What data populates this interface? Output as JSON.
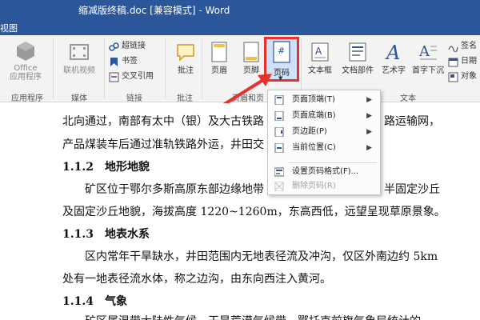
{
  "window": {
    "title": "缩减版终稿.doc [兼容模式] - Word"
  },
  "tabs": {
    "view": "视图"
  },
  "ribbon": {
    "office_apps": "Office\n应用程序",
    "online_video": "联机视频",
    "hyperlink": "超链接",
    "bookmark": "书签",
    "cross_ref": "交叉引用",
    "comment": "批注",
    "header": "页眉",
    "footer": "页脚",
    "page_number": "页码",
    "textbox": "文本框",
    "quick_parts": "文档部件",
    "wordart": "艺术字",
    "drop_cap": "首字下沉",
    "signature": "签名",
    "date": "日期",
    "object": "对象",
    "groups": {
      "apps": "应用程序",
      "media": "媒体",
      "links": "链接",
      "comments": "批注",
      "header_footer": "页眉和页",
      "text": "文本"
    }
  },
  "menu": {
    "items": [
      {
        "label": "页面顶端(T)",
        "submenu": true,
        "enabled": true,
        "icon": "page-top-icon"
      },
      {
        "label": "页面底端(B)",
        "submenu": true,
        "enabled": true,
        "icon": "page-bottom-icon"
      },
      {
        "label": "页边距(P)",
        "submenu": true,
        "enabled": true,
        "icon": "page-margin-icon"
      },
      {
        "label": "当前位置(C)",
        "submenu": true,
        "enabled": true,
        "icon": "current-position-icon"
      },
      {
        "label": "设置页码格式(F)...",
        "submenu": false,
        "enabled": true,
        "icon": "format-page-number-icon"
      },
      {
        "label": "删除页码(R)",
        "submenu": false,
        "enabled": false,
        "icon": "remove-page-number-icon"
      }
    ]
  },
  "document": {
    "lines": [
      {
        "text": "北向通过，南部有太中（银）及大古铁路",
        "tail": "路运输网，",
        "kind": "body"
      },
      {
        "text": "产品煤装车后通过准轨铁路外运，井田交",
        "tail": "",
        "kind": "body"
      },
      {
        "text": "1.1.2　地形地貌",
        "tail": "",
        "kind": "heading"
      },
      {
        "text": "　　矿区位于鄂尔多斯高原东部边缘地带",
        "tail": "半固定沙丘",
        "kind": "body"
      },
      {
        "text": "及固定沙丘地貌，海拔高度 1220~1260m，东高西低，远望呈现草原景象。",
        "tail": "",
        "kind": "body"
      },
      {
        "text": "1.1.3　地表水系",
        "tail": "",
        "kind": "heading"
      },
      {
        "text": "　　区内常年干旱缺水，井田范围内无地表径流及冲沟，仅区外南边约 5km",
        "tail": "",
        "kind": "body"
      },
      {
        "text": "处有一地表径流水体，称之边沟，由东向西注入黄河。",
        "tail": "",
        "kind": "body"
      },
      {
        "text": "1.1.4　气象",
        "tail": "",
        "kind": "heading"
      },
      {
        "text": "　　矿区属温带大陆性气候，干旱荒漠气候带，鄂托克前旗气象局统计的",
        "tail": "",
        "kind": "body"
      }
    ]
  },
  "colors": {
    "title_bar": "#2b579a",
    "highlight": "#e8302f",
    "accent_icon": "#2b579a"
  }
}
